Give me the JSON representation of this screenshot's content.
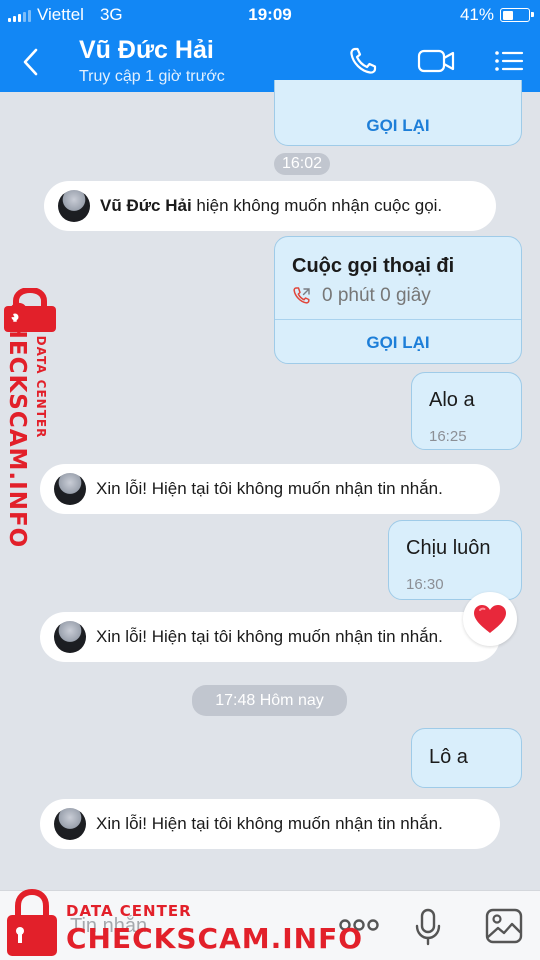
{
  "status_bar": {
    "carrier": "Viettel",
    "network": "3G",
    "time": "19:09",
    "battery_pct": "41%",
    "battery_level": 0.41
  },
  "header": {
    "contact_name": "Vũ Đức Hải",
    "contact_status": "Truy cập 1 giờ trước"
  },
  "colors": {
    "header": "#1287f5",
    "bubble": "#d9eefb",
    "accent": "#1d7ed8",
    "watermark": "#e2202a"
  },
  "chat": {
    "top_card": {
      "action": "GỌI LẠI"
    },
    "chip_1": "16:02",
    "notice_1": {
      "name": "Vũ Đức Hải",
      "text": "hiện không muốn nhận cuộc gọi."
    },
    "call_card": {
      "title": "Cuộc gọi thoại đi",
      "duration": "0 phút 0 giây",
      "action": "GỌI LẠI",
      "icon": "outgoing-call-icon"
    },
    "msg_1": {
      "text": "Alo a",
      "time": "16:25"
    },
    "notice_2": "Xin lỗi! Hiện tại tôi không muốn nhận tin nhắn.",
    "msg_2": {
      "text": "Chịu luôn",
      "time": "16:30"
    },
    "notice_3": "Xin lỗi! Hiện tại tôi không muốn nhận tin nhắn.",
    "reaction": "heart-icon",
    "chip_2": "17:48 Hôm nay",
    "msg_3": {
      "text": "Lô a"
    },
    "notice_4": "Xin lỗi! Hiện tại tôi không muốn nhận tin nhắn."
  },
  "composer": {
    "placeholder": "Tin nhắn"
  },
  "watermark": {
    "small": "DATA CENTER",
    "big": "CHECKSCAM.INFO"
  }
}
